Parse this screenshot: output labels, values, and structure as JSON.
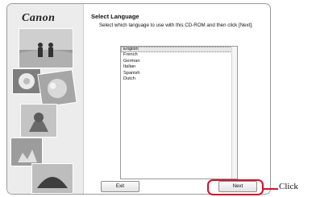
{
  "sidebar": {
    "brand": "Canon",
    "images": [
      "beach-couple-photo",
      "flower-photo",
      "fruit-photo",
      "dog-photo",
      "flower-bouquet-photo",
      "food-photo"
    ]
  },
  "dialog": {
    "title": "Select Language",
    "instruction": "Select which language to use with this CD-ROM and then click [Next].",
    "languages": [
      "English",
      "French",
      "German",
      "Italian",
      "Spanish",
      "Dutch"
    ],
    "selected": "English",
    "exit_label": "Exit",
    "next_label": "Next"
  },
  "annotation": {
    "label": "Click",
    "color": "#d2122c"
  }
}
